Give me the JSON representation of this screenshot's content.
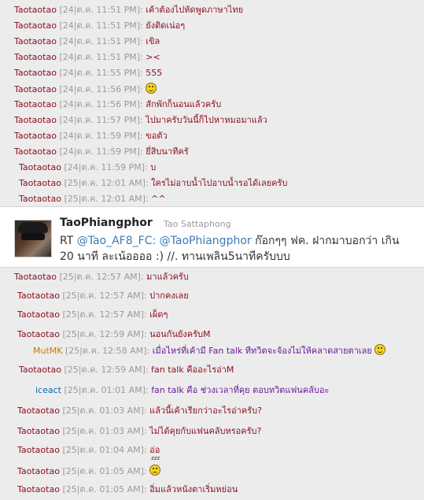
{
  "chat_before": [
    {
      "nick": "Taotaotao",
      "ts": "[24|ต.ค. 11:51 PM]",
      "msg": "เค้าต้องไปหัดพูดภาษาไทย"
    },
    {
      "nick": "Taotaotao",
      "ts": "[24|ต.ค. 11:51 PM]",
      "msg": "ยังติดเน่อๆ"
    },
    {
      "nick": "Taotaotao",
      "ts": "[24|ต.ค. 11:51 PM]",
      "msg": "เขิล"
    },
    {
      "nick": "Taotaotao",
      "ts": "[24|ต.ค. 11:51 PM]",
      "msg": "><"
    },
    {
      "nick": "Taotaotao",
      "ts": "[24|ต.ค. 11:55 PM]",
      "msg": "555"
    },
    {
      "nick": "Taotaotao",
      "ts": "[24|ต.ค. 11:56 PM]",
      "msg": "",
      "emoticon": "smile-emoticon"
    },
    {
      "nick": "Taotaotao",
      "ts": "[24|ต.ค. 11:56 PM]",
      "msg": "สักพักก็นอนแล้วครับ"
    },
    {
      "nick": "Taotaotao",
      "ts": "[24|ต.ค. 11:57 PM]",
      "msg": "ไปมาครับวันนี้ก็ไปหาหมอมาแล้ว"
    },
    {
      "nick": "Taotaotao",
      "ts": "[24|ต.ค. 11:59 PM]",
      "msg": "ขอตัว"
    },
    {
      "nick": "Taotaotao",
      "ts": "[24|ต.ค. 11:59 PM]",
      "msg": "ยี่สิบนาทีครั"
    },
    {
      "nick": "Taotaotao",
      "ts": "[24|ต.ค. 11:59 PM]",
      "msg": "บ"
    },
    {
      "nick": "Taotaotao",
      "ts": "[25|ต.ค. 12:01 AM]",
      "msg": "ใครไม่อาบน้ำไปอาบน้ำรอได้เลยครับ"
    },
    {
      "nick": "Taotaotao",
      "ts": "[25|ต.ค. 12:01 AM]",
      "msg": "^^"
    }
  ],
  "tweet": {
    "name": "TaoPhiangphor",
    "real_name": "Tao Sattaphong",
    "rt": "RT",
    "mention1": "@Tao_AF8_FC:",
    "mention2": "@TaoPhiangphor",
    "text1": "ก๊อกๆๆ ฟค. ฝากมาบอกว่า เกิน",
    "text2": "20 นาที ละเน้ออออ :) //. ทานเพลิน5นาทีครับบบ"
  },
  "chat_after": [
    {
      "nick": "Taotaotao",
      "ts": "[25|ต.ค. 12:57 AM]",
      "msg": "มาแล้วครับ"
    },
    {
      "nick": "Taotaotao",
      "ts": "[25|ต.ค. 12:57 AM]",
      "msg": "ปากคงเลย"
    },
    {
      "nick": "Taotaotao",
      "ts": "[25|ต.ค. 12:57 AM]",
      "msg": "เผ็ดๆ"
    },
    {
      "nick": "Taotaotao",
      "ts": "[25|ต.ค. 12:59 AM]",
      "msg": "นอนกันยังครับM"
    },
    {
      "nick": "MutMK",
      "ts": "[25|ต.ค. 12:58 AM]",
      "msg": "เมื่อไหร่ที่เค้ามี Fan talk ทีทวิตจะจ้องไม่ให้คลาดสายตาเลย",
      "emoticon": "smile-emoticon"
    },
    {
      "nick": "Taotaotao",
      "ts": "[25|ต.ค. 12:59 AM]",
      "msg": "fan talk คืออะไรอ่าM"
    },
    {
      "nick": "iceact",
      "ts": "[25|ต.ค. 01:01 AM]",
      "msg": "fan talk คือ ช่วงเวลาที่คุย ตอบทวิตแฟนคลับอะ"
    },
    {
      "nick": "Taotaotao",
      "ts": "[25|ต.ค. 01:03 AM]",
      "msg": "แล้วนี้เค้าเรียกว่าอะไรอ่าครับ?"
    },
    {
      "nick": "Taotaotao",
      "ts": "[25|ต.ค. 01:03 AM]",
      "msg": "ไม่ได้คุยกับแฟนคลับหรอครับ?"
    },
    {
      "nick": "Taotaotao",
      "ts": "[25|ต.ค. 01:04 AM]",
      "msg": "อ่อ"
    },
    {
      "nick": "Taotaotao",
      "ts": "[25|ต.ค. 01:05 AM]",
      "msg": "",
      "emoticon": "sleepy-emoticon",
      "emoticon_text": "zzz"
    },
    {
      "nick": "Taotaotao",
      "ts": "[25|ต.ค. 01:05 AM]",
      "msg": "อิ่มแล้วหนังตาเริ่มหย่อน"
    }
  ],
  "colors": {
    "nick": "#8b0d1f",
    "timestamp": "#9a9a9a",
    "mutmk": "#cc7a00",
    "iceact": "#0a6aa8",
    "purple_msg": "#6a1a9a",
    "link": "#3a7bb7"
  }
}
